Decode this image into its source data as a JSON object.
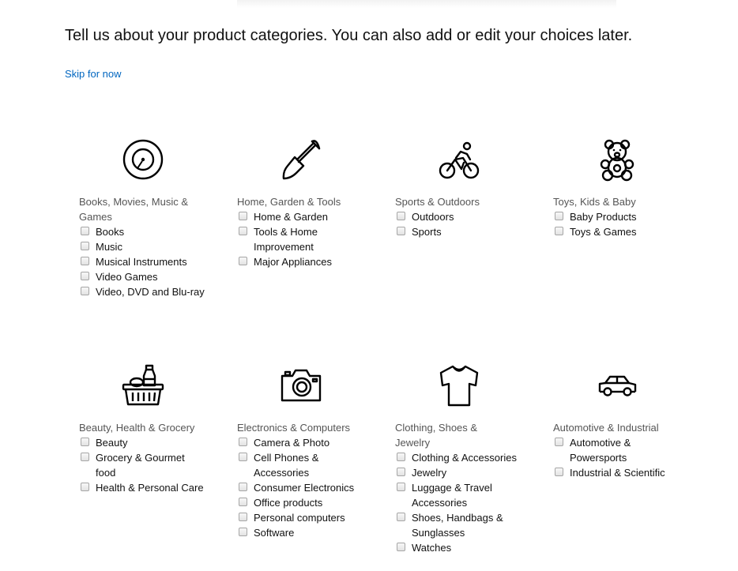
{
  "header": {
    "title": "Tell us about your product categories. You can also add or edit your choices later.",
    "skip_label": "Skip for now"
  },
  "colors": {
    "link": "#0066c0",
    "category_title": "#555555",
    "text": "#111111",
    "checkbox_border": "#a6a6a6"
  },
  "categories": [
    {
      "title": "Books, Movies, Music & Games",
      "icon": "vinyl-record-icon",
      "options": [
        "Books",
        "Music",
        "Musical Instruments",
        "Video Games",
        "Video, DVD and Blu-ray"
      ]
    },
    {
      "title": "Home, Garden & Tools",
      "icon": "shovel-icon",
      "options": [
        "Home & Garden",
        "Tools & Home Improvement",
        "Major Appliances"
      ]
    },
    {
      "title": "Sports & Outdoors",
      "icon": "cyclist-icon",
      "options": [
        "Outdoors",
        "Sports"
      ]
    },
    {
      "title": "Toys, Kids & Baby",
      "icon": "teddy-bear-icon",
      "options": [
        "Baby Products",
        "Toys & Games"
      ]
    },
    {
      "title": "Beauty, Health & Grocery",
      "icon": "grocery-basket-icon",
      "options": [
        "Beauty",
        "Grocery & Gourmet food",
        "Health & Personal Care"
      ]
    },
    {
      "title": "Electronics & Computers",
      "icon": "camera-icon",
      "options": [
        "Camera & Photo",
        "Cell Phones & Accessories",
        "Consumer Electronics",
        "Office products",
        "Personal computers",
        "Software"
      ]
    },
    {
      "title": "Clothing, Shoes & Jewelry",
      "icon": "tshirt-icon",
      "options": [
        "Clothing & Accessories",
        "Jewelry",
        "Luggage & Travel Accessories",
        "Shoes, Handbags & Sunglasses",
        "Watches"
      ]
    },
    {
      "title": "Automotive & Industrial",
      "icon": "car-icon",
      "options": [
        "Automotive & Powersports",
        "Industrial & Scientific"
      ]
    }
  ]
}
